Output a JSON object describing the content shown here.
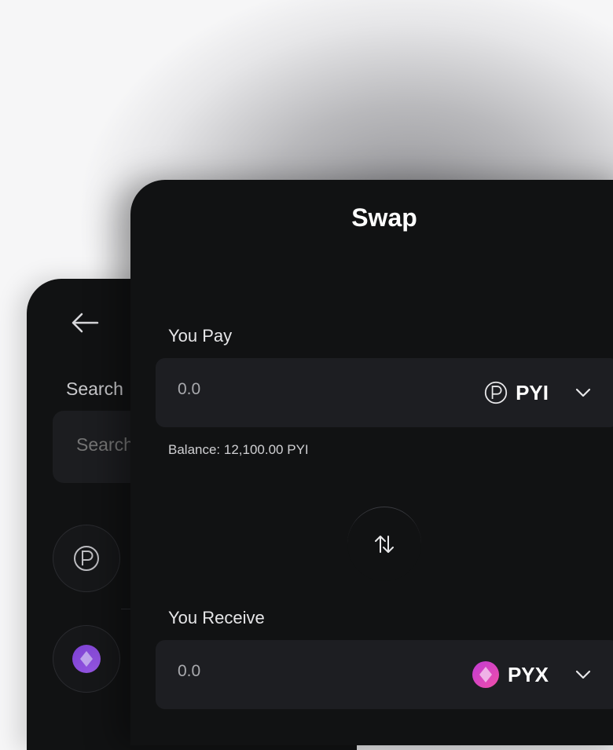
{
  "back_panel": {
    "search_label": "Search",
    "search_placeholder": "Search",
    "token_icons": [
      "pyi-token-icon",
      "pyx-token-icon"
    ]
  },
  "swap": {
    "title": "Swap",
    "pay": {
      "label": "You Pay",
      "amount": "0.0",
      "token": "PYI",
      "balance": "Balance: 12,100.00 PYI"
    },
    "receive": {
      "label": "You Receive",
      "amount": "0.0",
      "token": "PYX"
    }
  },
  "colors": {
    "panel_bg": "#111213",
    "field_bg": "#1d1e22",
    "pyx_gradient_start": "#c13bd4",
    "pyx_gradient_end": "#f04fa8",
    "text": "#ffffff"
  }
}
